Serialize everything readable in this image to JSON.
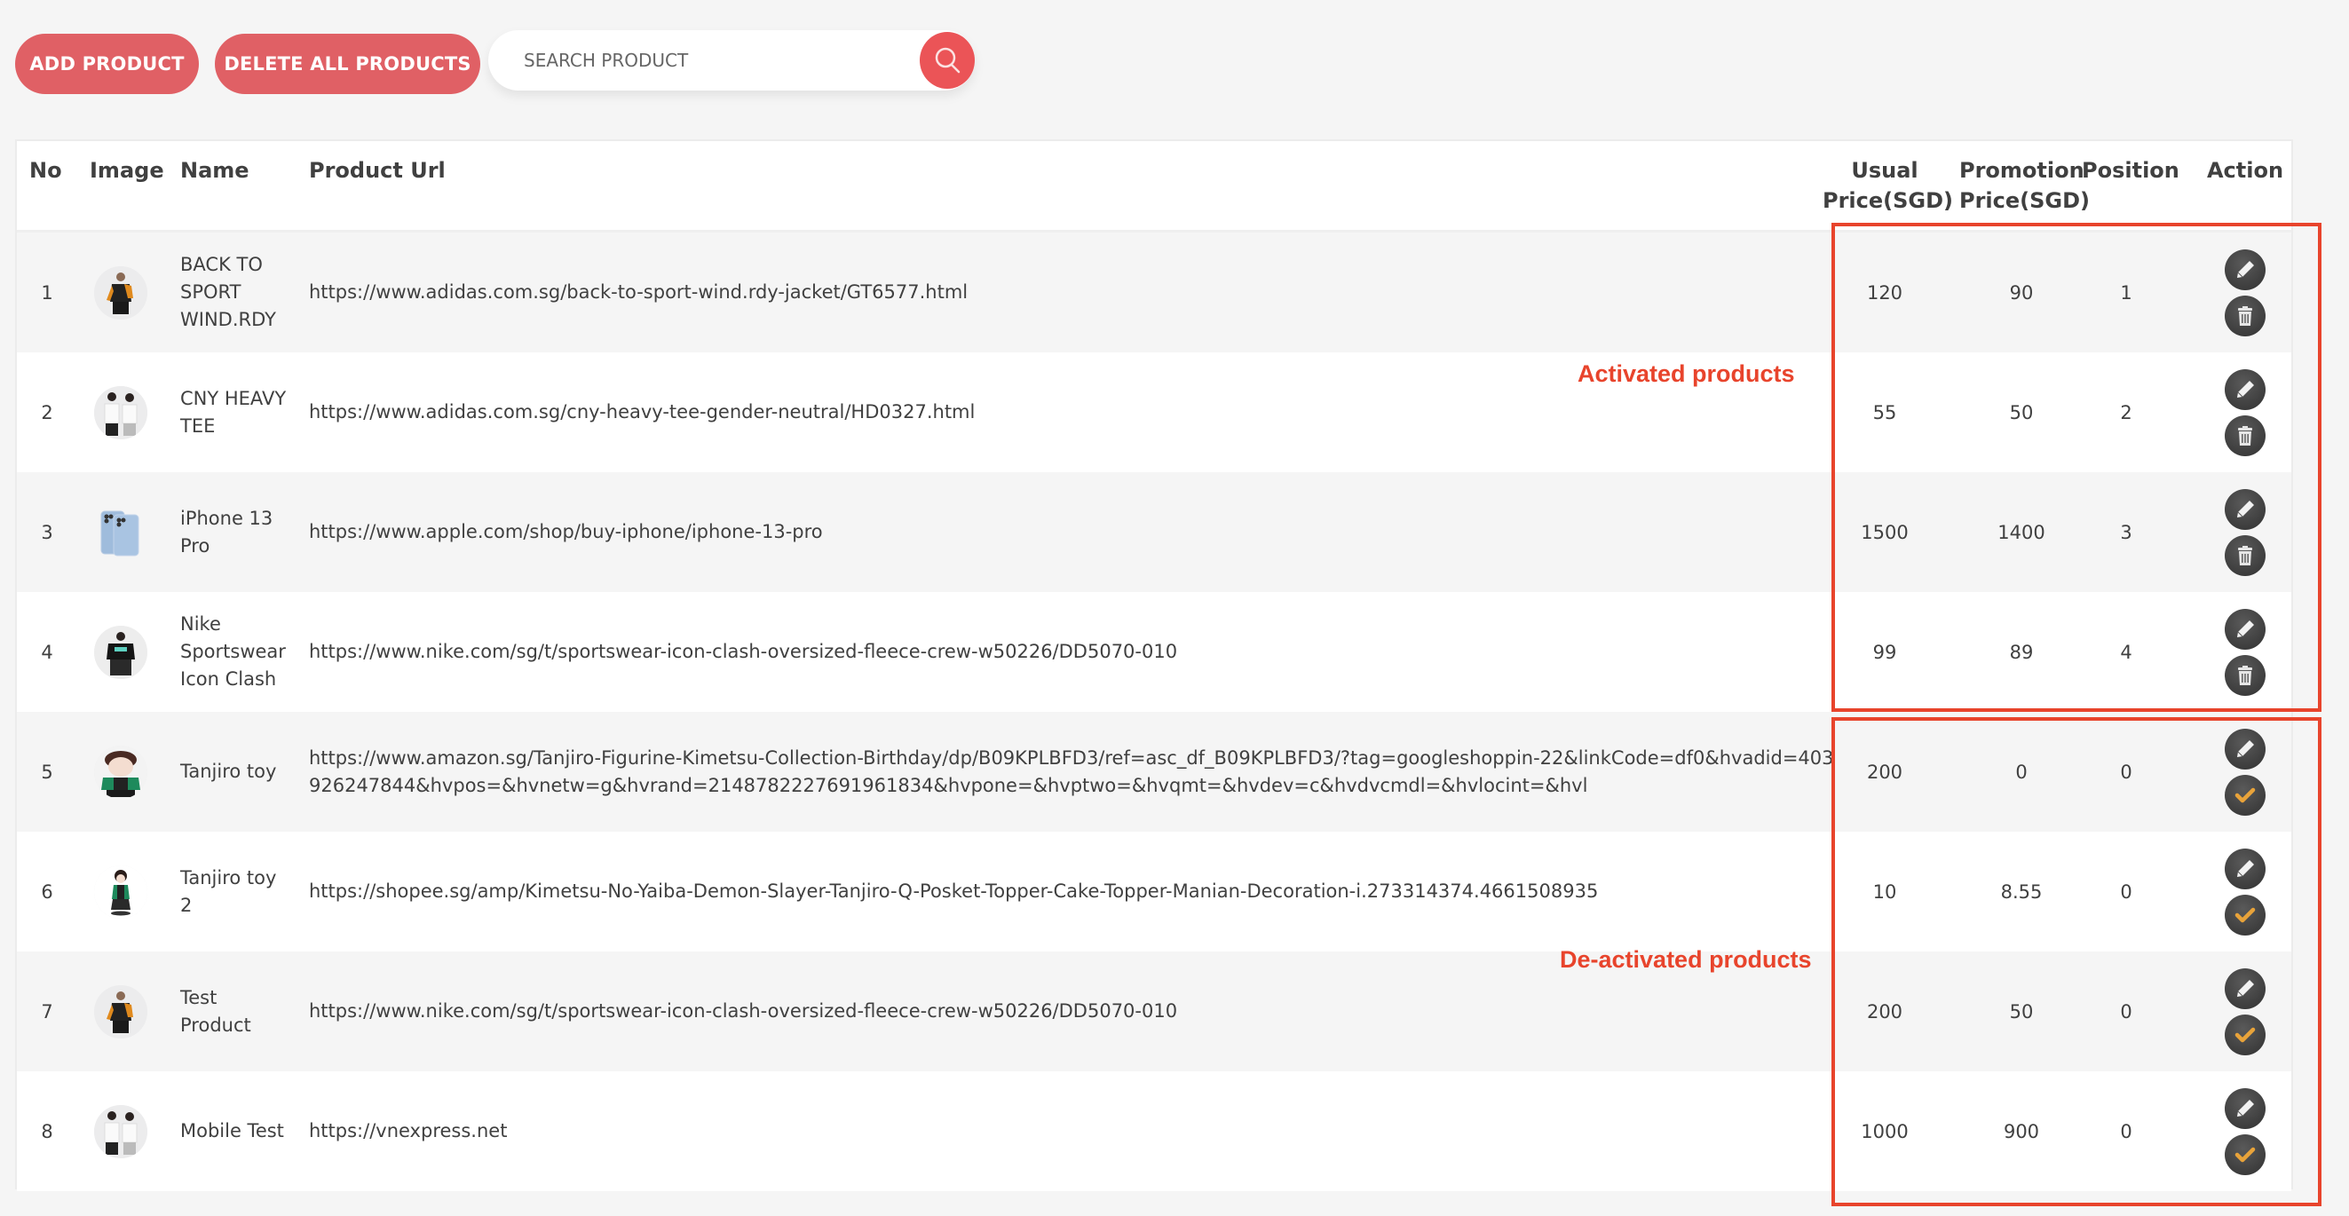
{
  "toolbar": {
    "add_label": "ADD PRODUCT",
    "delete_all_label": "DELETE ALL PRODUCTS",
    "search_placeholder": "SEARCH PRODUCT",
    "search_value": "",
    "search_icon": "search-icon"
  },
  "colors": {
    "button_bg": "#e06065",
    "search_button_bg": "#eb5457",
    "annotation": "#e8442c",
    "action_icon_bg": "#434343",
    "activate_check": "#e8a33a"
  },
  "table": {
    "headers": {
      "no": "No",
      "image": "Image",
      "name": "Name",
      "url": "Product Url",
      "usual_line1": "Usual",
      "usual_line2": "Price(SGD)",
      "promo_line1": "Promotion",
      "promo_line2": "Price(SGD)",
      "position": "Position",
      "action": "Action"
    },
    "rows": [
      {
        "no": "1",
        "image": "adidas-jacket-thumbnail",
        "name": "BACK TO SPORT WIND.RDY",
        "url": "https://www.adidas.com.sg/back-to-sport-wind.rdy-jacket/GT6577.html",
        "usual": "120",
        "promo": "90",
        "position": "1",
        "status": "active",
        "actions": [
          "edit-icon",
          "trash-icon"
        ]
      },
      {
        "no": "2",
        "image": "adidas-tee-couple-thumbnail",
        "name": "CNY HEAVY TEE",
        "url": "https://www.adidas.com.sg/cny-heavy-tee-gender-neutral/HD0327.html",
        "usual": "55",
        "promo": "50",
        "position": "2",
        "status": "active",
        "actions": [
          "edit-icon",
          "trash-icon"
        ]
      },
      {
        "no": "3",
        "image": "iphone-thumbnail",
        "name": "iPhone 13 Pro",
        "url": "https://www.apple.com/shop/buy-iphone/iphone-13-pro",
        "usual": "1500",
        "promo": "1400",
        "position": "3",
        "status": "active",
        "actions": [
          "edit-icon",
          "trash-icon"
        ]
      },
      {
        "no": "4",
        "image": "nike-sweater-thumbnail",
        "name": "Nike Sportswear Icon Clash",
        "url": "https://www.nike.com/sg/t/sportswear-icon-clash-oversized-fleece-crew-w50226/DD5070-010",
        "usual": "99",
        "promo": "89",
        "position": "4",
        "status": "active",
        "actions": [
          "edit-icon",
          "trash-icon"
        ]
      },
      {
        "no": "5",
        "image": "tanjiro-figurine-thumbnail",
        "name": "Tanjiro toy",
        "url": "https://www.amazon.sg/Tanjiro-Figurine-Kimetsu-Collection-Birthday/dp/B09KPLBFD3/ref=asc_df_B09KPLBFD3/?tag=googleshoppin-22&linkCode=df0&hvadid=403926247844&hvpos=&hvnetw=g&hvrand=2148782227691961834&hvpone=&hvptwo=&hvqmt=&hvdev=c&hvdvcmdl=&hvlocint=&hvl",
        "usual": "200",
        "promo": "0",
        "position": "0",
        "status": "inactive",
        "actions": [
          "edit-icon",
          "check-icon"
        ]
      },
      {
        "no": "6",
        "image": "tanjiro-qposket-thumbnail",
        "name": "Tanjiro toy 2",
        "url": "https://shopee.sg/amp/Kimetsu-No-Yaiba-Demon-Slayer-Tanjiro-Q-Posket-Topper-Cake-Topper-Manian-Decoration-i.273314374.4661508935",
        "usual": "10",
        "promo": "8.55",
        "position": "0",
        "status": "inactive",
        "actions": [
          "edit-icon",
          "check-icon"
        ]
      },
      {
        "no": "7",
        "image": "adidas-jacket-thumbnail",
        "name": "Test Product",
        "url": "https://www.nike.com/sg/t/sportswear-icon-clash-oversized-fleece-crew-w50226/DD5070-010",
        "usual": "200",
        "promo": "50",
        "position": "0",
        "status": "inactive",
        "actions": [
          "edit-icon",
          "check-icon"
        ]
      },
      {
        "no": "8",
        "image": "adidas-tee-couple-thumbnail",
        "name": "Mobile Test",
        "url": "https://vnexpress.net",
        "usual": "1000",
        "promo": "900",
        "position": "0",
        "status": "inactive",
        "actions": [
          "edit-icon",
          "check-icon"
        ]
      }
    ]
  },
  "annotations": {
    "active_label": "Activated products",
    "inactive_label": "De-activated products"
  }
}
